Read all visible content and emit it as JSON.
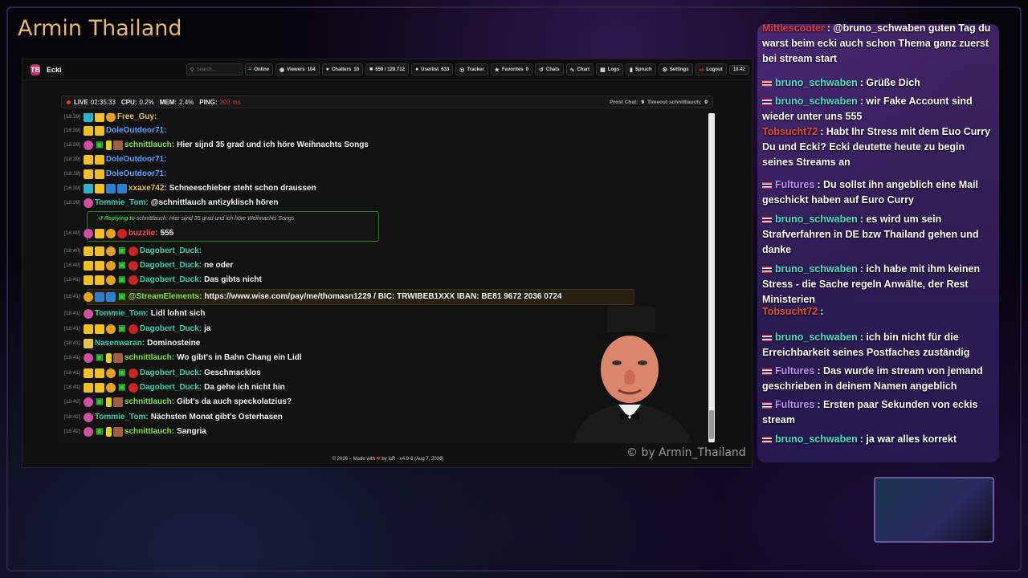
{
  "stream": {
    "title": "Armin Thailand",
    "watermark": "© by Armin_Thailand"
  },
  "app": {
    "name": "Ecki",
    "logo": "TB",
    "search_placeholder": "Search...",
    "toolbar": {
      "online": "Online",
      "viewers": "Viewers",
      "viewers_count": "104",
      "chatters": "Chatters",
      "chatters_count": "10",
      "messages": "559 / 129.712",
      "userlist": "Userlist",
      "userlist_count": "633",
      "tracker": "Tracker",
      "favorites": "Favorites",
      "favorites_count": "0",
      "chats": "Chats",
      "chart": "Chart",
      "logs": "Logs",
      "spruch": "Spruch",
      "settings": "Settings",
      "logout": "Logout",
      "time": "18:42"
    },
    "status": {
      "live_label": "LIVE",
      "live_time": "02:35:33",
      "cpu_label": "CPU:",
      "cpu": "0.2%",
      "mem_label": "MEM:",
      "mem": "2.4%",
      "ping_label": "PING:",
      "ping": "202 ms",
      "prost_label": "Prost Chat:",
      "prost": "9",
      "timeout_label": "Timeout schnittlauch:",
      "timeout": "0"
    },
    "footer": {
      "before": "© 2026 – Made with",
      "after": "by IcR · v4.9-6 (Aug 7, 2026)"
    }
  },
  "chat": {
    "reply_prefix": "Replying to",
    "reply_text": "schnittlauch: Hier sijnd 35 grad und ich höre Weihnachts Songs",
    "messages": [
      {
        "ts": "[18:39]",
        "user": "Free_Guy:",
        "color": "#e0c050",
        "text": ""
      },
      {
        "ts": "[18:39]",
        "user": "DoleOutdoor71:",
        "color": "#5aa0ff",
        "text": ""
      },
      {
        "ts": "[18:39]",
        "user": "schnittlauch:",
        "color": "#7ee040",
        "text": "Hier sijnd 35 grad und ich höre Weihnachts Songs"
      },
      {
        "ts": "[18:39]",
        "user": "DoleOutdoor71:",
        "color": "#5aa0ff",
        "text": ""
      },
      {
        "ts": "[18:39]",
        "user": "DoleOutdoor71:",
        "color": "#5aa0ff",
        "text": ""
      },
      {
        "ts": "[18:39]",
        "user": "xxaxe742:",
        "color": "#e0c050",
        "text": "Schneeschieber steht schon draussen"
      },
      {
        "ts": "[18:39]",
        "user": "Tommie_Tom:",
        "color": "#2ed0b0",
        "text": "@schnittlauch antizyklisch hören"
      },
      {
        "ts": "[18:40]",
        "user": "buzzlie:",
        "color": "#ff4a4a",
        "text": "555"
      },
      {
        "ts": "[18:40]",
        "user": "Dagobert_Duck:",
        "color": "#2ed0b0",
        "text": ""
      },
      {
        "ts": "[18:40]",
        "user": "Dagobert_Duck:",
        "color": "#2ed0b0",
        "text": "ne oder"
      },
      {
        "ts": "[18:41]",
        "user": "Dagobert_Duck:",
        "color": "#2ed0b0",
        "text": "Das gibts nicht"
      },
      {
        "ts": "[18:41]",
        "user": "@StreamElements:",
        "color": "#7ee040",
        "text": "https://www.wise.com/pay/me/thomasn1229 / BIC: TRWIBEB1XXX IBAN: BE81 9672 2036 0724"
      },
      {
        "ts": "[18:41]",
        "user": "Tommie_Tom:",
        "color": "#2ed0b0",
        "text": "Lidl lohnt sich"
      },
      {
        "ts": "[18:41]",
        "user": "Dagobert_Duck:",
        "color": "#2ed0b0",
        "text": "ja"
      },
      {
        "ts": "[18:41]",
        "user": "Nasenwaran:",
        "color": "#2ed0b0",
        "text": "Dominosteine"
      },
      {
        "ts": "[18:41]",
        "user": "schnittlauch:",
        "color": "#7ee040",
        "text": "Wo gibt's in Bahn Chang ein Lidl"
      },
      {
        "ts": "[18:41]",
        "user": "Dagobert_Duck:",
        "color": "#2ed0b0",
        "text": "Geschmacklos"
      },
      {
        "ts": "[18:41]",
        "user": "Dagobert_Duck:",
        "color": "#2ed0b0",
        "text": "Da gehe ich nicht hin"
      },
      {
        "ts": "[18:42]",
        "user": "schnittlauch:",
        "color": "#7ee040",
        "text": "Gibt's da auch speckolatzius?"
      },
      {
        "ts": "[18:42]",
        "user": "Tommie_Tom:",
        "color": "#2ed0b0",
        "text": "Nächsten Monat gibt's Osterhasen"
      },
      {
        "ts": "[18:42]",
        "user": "schnittlauch:",
        "color": "#7ee040",
        "text": "Sangria"
      }
    ]
  },
  "overlay": {
    "messages": [
      {
        "user": "Mittlescooter",
        "cls": "u-mitt",
        "flag": false,
        "text": ": @bruno_schwaben guten Tag du warst beim ecki auch schon Thema ganz zuerst bei stream start"
      },
      {
        "user": "bruno_schwaben",
        "cls": "u-bruno",
        "flag": true,
        "text": ": Grüße Dich"
      },
      {
        "user": "bruno_schwaben",
        "cls": "u-bruno",
        "flag": true,
        "text": ": wir Fake Account sind wieder unter uns 555"
      },
      {
        "user": "Tobsucht72",
        "cls": "u-tob",
        "flag": false,
        "text": ": Habt Ihr Stress mit dem Euo Curry Du und Ecki? Ecki deutette heute zu begin seines Streams an"
      },
      {
        "user": "Fultures",
        "cls": "u-full",
        "flag": true,
        "text": ": Du sollst ihn angeblich eine Mail geschickt haben auf Euro Curry"
      },
      {
        "user": "bruno_schwaben",
        "cls": "u-bruno",
        "flag": true,
        "text": ": es wird um sein Strafverfahren in DE bzw Thailand gehen und danke"
      },
      {
        "user": "bruno_schwaben",
        "cls": "u-bruno",
        "flag": true,
        "text": ": ich habe mit ihm keinen Stress - die Sache regeln Anwälte, der Rest Ministerien"
      },
      {
        "user": "Tobsucht72",
        "cls": "u-tob",
        "flag": false,
        "text": ":"
      },
      {
        "user": "bruno_schwaben",
        "cls": "u-bruno",
        "flag": true,
        "text": ": ich bin nicht für die Erreichbarkeit seines Postfaches zuständig"
      },
      {
        "user": "Fultures",
        "cls": "u-full",
        "flag": true,
        "text": ": Das wurde im stream von jemand geschrieben in deinem Namen angeblich"
      },
      {
        "user": "Fultures",
        "cls": "u-full",
        "flag": true,
        "text": ": Ersten paar Sekunden von eckis stream"
      },
      {
        "user": "bruno_schwaben",
        "cls": "u-bruno",
        "flag": true,
        "text": ": ja war alles korrekt"
      }
    ]
  },
  "colors": {
    "accent_online": "#33cc33",
    "accent_logout": "#ee3333",
    "reply_border": "#2c7a2c"
  }
}
